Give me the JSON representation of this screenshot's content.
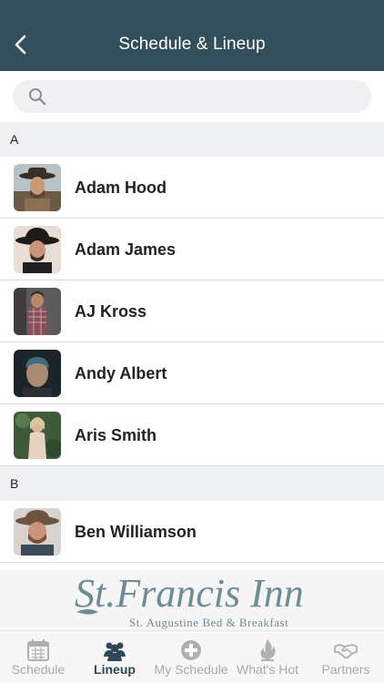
{
  "header": {
    "title": "Schedule & Lineup"
  },
  "search": {
    "placeholder": ""
  },
  "sections": [
    {
      "letter": "A",
      "artists": [
        {
          "name": "Adam Hood"
        },
        {
          "name": "Adam James"
        },
        {
          "name": "AJ Kross"
        },
        {
          "name": "Andy Albert"
        },
        {
          "name": "Aris Smith"
        }
      ]
    },
    {
      "letter": "B",
      "artists": [
        {
          "name": "Ben Williamson"
        }
      ]
    }
  ],
  "banner": {
    "line1": "St.Francis Inn",
    "line2": "St. Augustine Bed & Breakfast"
  },
  "tabs": [
    {
      "label": "Schedule",
      "icon": "calendar-icon",
      "active": false
    },
    {
      "label": "Lineup",
      "icon": "people-icon",
      "active": true
    },
    {
      "label": "My Schedule",
      "icon": "plus-circle-icon",
      "active": false
    },
    {
      "label": "What's Hot",
      "icon": "flame-icon",
      "active": false
    },
    {
      "label": "Partners",
      "icon": "handshake-icon",
      "active": false
    }
  ],
  "colors": {
    "header_bg": "#344f5c",
    "active_tab": "#2d4756",
    "inactive_tab": "#a8a8a8",
    "banner_text": "#6f8c94"
  }
}
